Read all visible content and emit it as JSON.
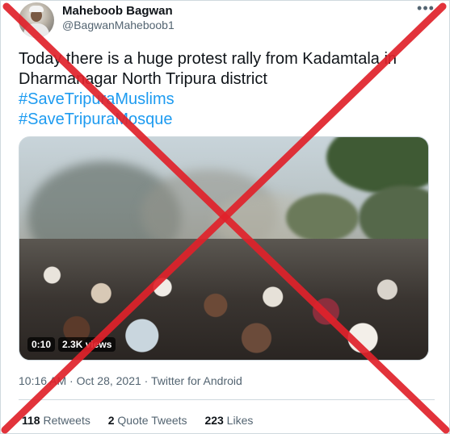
{
  "author": {
    "name": "Maheboob Bagwan",
    "handle": "@BagwanMaheboob1",
    "more_label": "•••"
  },
  "tweet": {
    "line1": "Today there is a huge protest rally from Kadamtala in",
    "line2": "Dharmanagar North Tripura district",
    "hashtag1": "#SaveTripuraMuslims",
    "hashtag2": "#SaveTripuraMosque"
  },
  "media": {
    "duration": "0:10",
    "views": "2.3K views"
  },
  "meta": {
    "time": "10:16 AM",
    "sep1": " · ",
    "date": "Oct 28, 2021",
    "sep2": " · ",
    "source": "Twitter for Android"
  },
  "stats": {
    "retweets_count": "118",
    "retweets_label": " Retweets",
    "quotes_count": "2",
    "quotes_label": " Quote Tweets",
    "likes_count": "223",
    "likes_label": " Likes"
  },
  "overlay": {
    "cross_color": "#e0222a"
  }
}
